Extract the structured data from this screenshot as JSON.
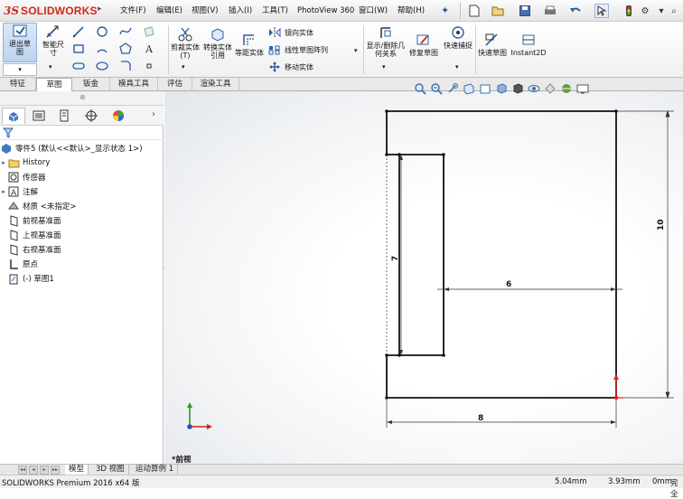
{
  "app": {
    "logo_ds": "3S",
    "logo_name": "SOLIDWORKS"
  },
  "menu": [
    {
      "label": "文件(F)"
    },
    {
      "label": "编辑(E)"
    },
    {
      "label": "视图(V)"
    },
    {
      "label": "插入(I)"
    },
    {
      "label": "工具(T)"
    },
    {
      "label": "PhotoView 360"
    },
    {
      "label": "窗口(W)"
    },
    {
      "label": "帮助(H)"
    }
  ],
  "ribbon": {
    "exit_sketch": "退出草图",
    "smart_dim": "智能尺寸",
    "trim": "剪裁实体(T)",
    "convert": "转换实体引用",
    "offset": "等距实体",
    "mirror": "镜向实体",
    "linear_pattern": "线性草图阵列",
    "move": "移动实体",
    "display_relations": "显示/删除几何关系",
    "repair": "修复草图",
    "quick_snaps": "快速捕捉",
    "rapid_sketch": "快速草图",
    "instant2d": "Instant2D"
  },
  "cmd_tabs": [
    {
      "label": "特征"
    },
    {
      "label": "草图"
    },
    {
      "label": "钣金"
    },
    {
      "label": "模具工具"
    },
    {
      "label": "评估"
    },
    {
      "label": "渲染工具"
    }
  ],
  "active_cmd_tab": "草图",
  "tree": {
    "root": "零件5 (默认<<默认>_显示状态 1>)",
    "items": [
      {
        "label": "History",
        "expandable": true
      },
      {
        "label": "传感器",
        "expandable": false
      },
      {
        "label": "注解",
        "expandable": true
      },
      {
        "label": "材质 <未指定>",
        "expandable": false
      },
      {
        "label": "前视基准面",
        "expandable": false
      },
      {
        "label": "上视基准面",
        "expandable": false
      },
      {
        "label": "右视基准面",
        "expandable": false
      },
      {
        "label": "原点",
        "expandable": false
      },
      {
        "label": "(-) 草图1",
        "expandable": false
      }
    ]
  },
  "sketch": {
    "dims": {
      "height": "10",
      "inner_height": "7",
      "inner_width": "6",
      "width": "8"
    },
    "view_label": "*前视"
  },
  "bottom_tabs": [
    {
      "label": "模型"
    },
    {
      "label": "3D 视图"
    },
    {
      "label": "运动算例 1"
    }
  ],
  "status": {
    "product": "SOLIDWORKS Premium 2016 x64 版",
    "x": "5.04mm",
    "y": "3.93mm",
    "z": "0mm",
    "state": "完全"
  },
  "colors": {
    "accent": "#d4251d",
    "tab_blue": "#2a5fa8",
    "origin_red": "#e02020"
  }
}
